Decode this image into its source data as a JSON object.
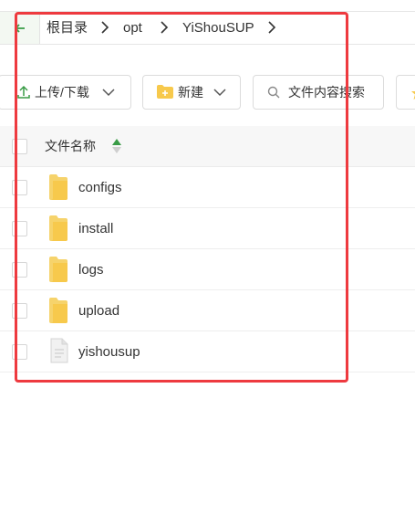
{
  "breadcrumb": {
    "items": [
      "根目录",
      "opt",
      "YiShouSUP"
    ]
  },
  "toolbar": {
    "upload_download_label": "上传/下载",
    "new_label": "新建",
    "search_placeholder": "文件内容搜索"
  },
  "table": {
    "column_name": "文件名称",
    "rows": [
      {
        "name": "configs",
        "type": "folder"
      },
      {
        "name": "install",
        "type": "folder"
      },
      {
        "name": "logs",
        "type": "folder"
      },
      {
        "name": "upload",
        "type": "folder"
      },
      {
        "name": "yishousup",
        "type": "file"
      }
    ]
  },
  "colors": {
    "accent_green": "#3a9c47",
    "folder_yellow": "#f7c94c",
    "highlight_red": "#ee3a3f"
  },
  "icons": [
    "back-arrow-icon",
    "chevron-right-icon",
    "upload-icon",
    "chevron-down-icon",
    "new-folder-icon",
    "search-icon",
    "star-icon",
    "sort-icon",
    "folder-icon",
    "file-icon"
  ]
}
